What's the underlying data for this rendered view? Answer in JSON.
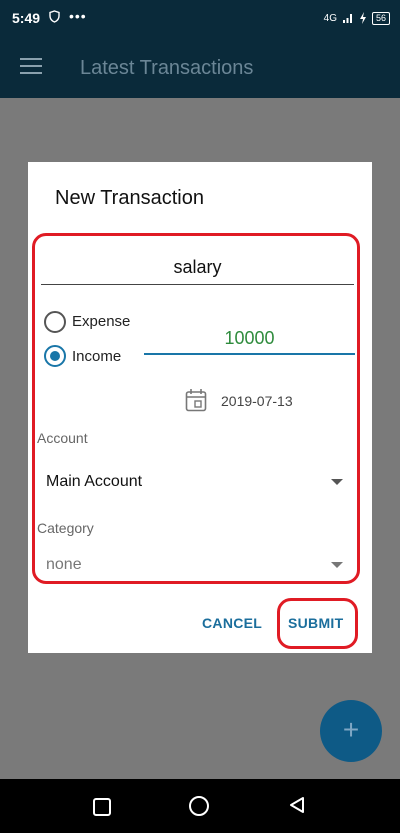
{
  "status_bar": {
    "time": "5:49",
    "dots": "•••",
    "network": "4G",
    "battery": "56"
  },
  "app_bar": {
    "title": "Latest Transactions"
  },
  "dialog": {
    "title": "New Transaction",
    "name_value": "salary",
    "radios": {
      "expense_label": "Expense",
      "income_label": "Income",
      "selected": "Income"
    },
    "amount_value": "10000",
    "date_value": "2019-07-13",
    "account": {
      "label": "Account",
      "value": "Main Account"
    },
    "category": {
      "label": "Category",
      "value": "none"
    },
    "cancel_label": "CANCEL",
    "submit_label": "SUBMIT"
  },
  "fab": {
    "label": "+"
  },
  "colors": {
    "accent": "#1976a8",
    "amount_text": "#2e8b3c",
    "highlight": "#e01b24",
    "app_bar_bg": "#0a2a3a"
  }
}
